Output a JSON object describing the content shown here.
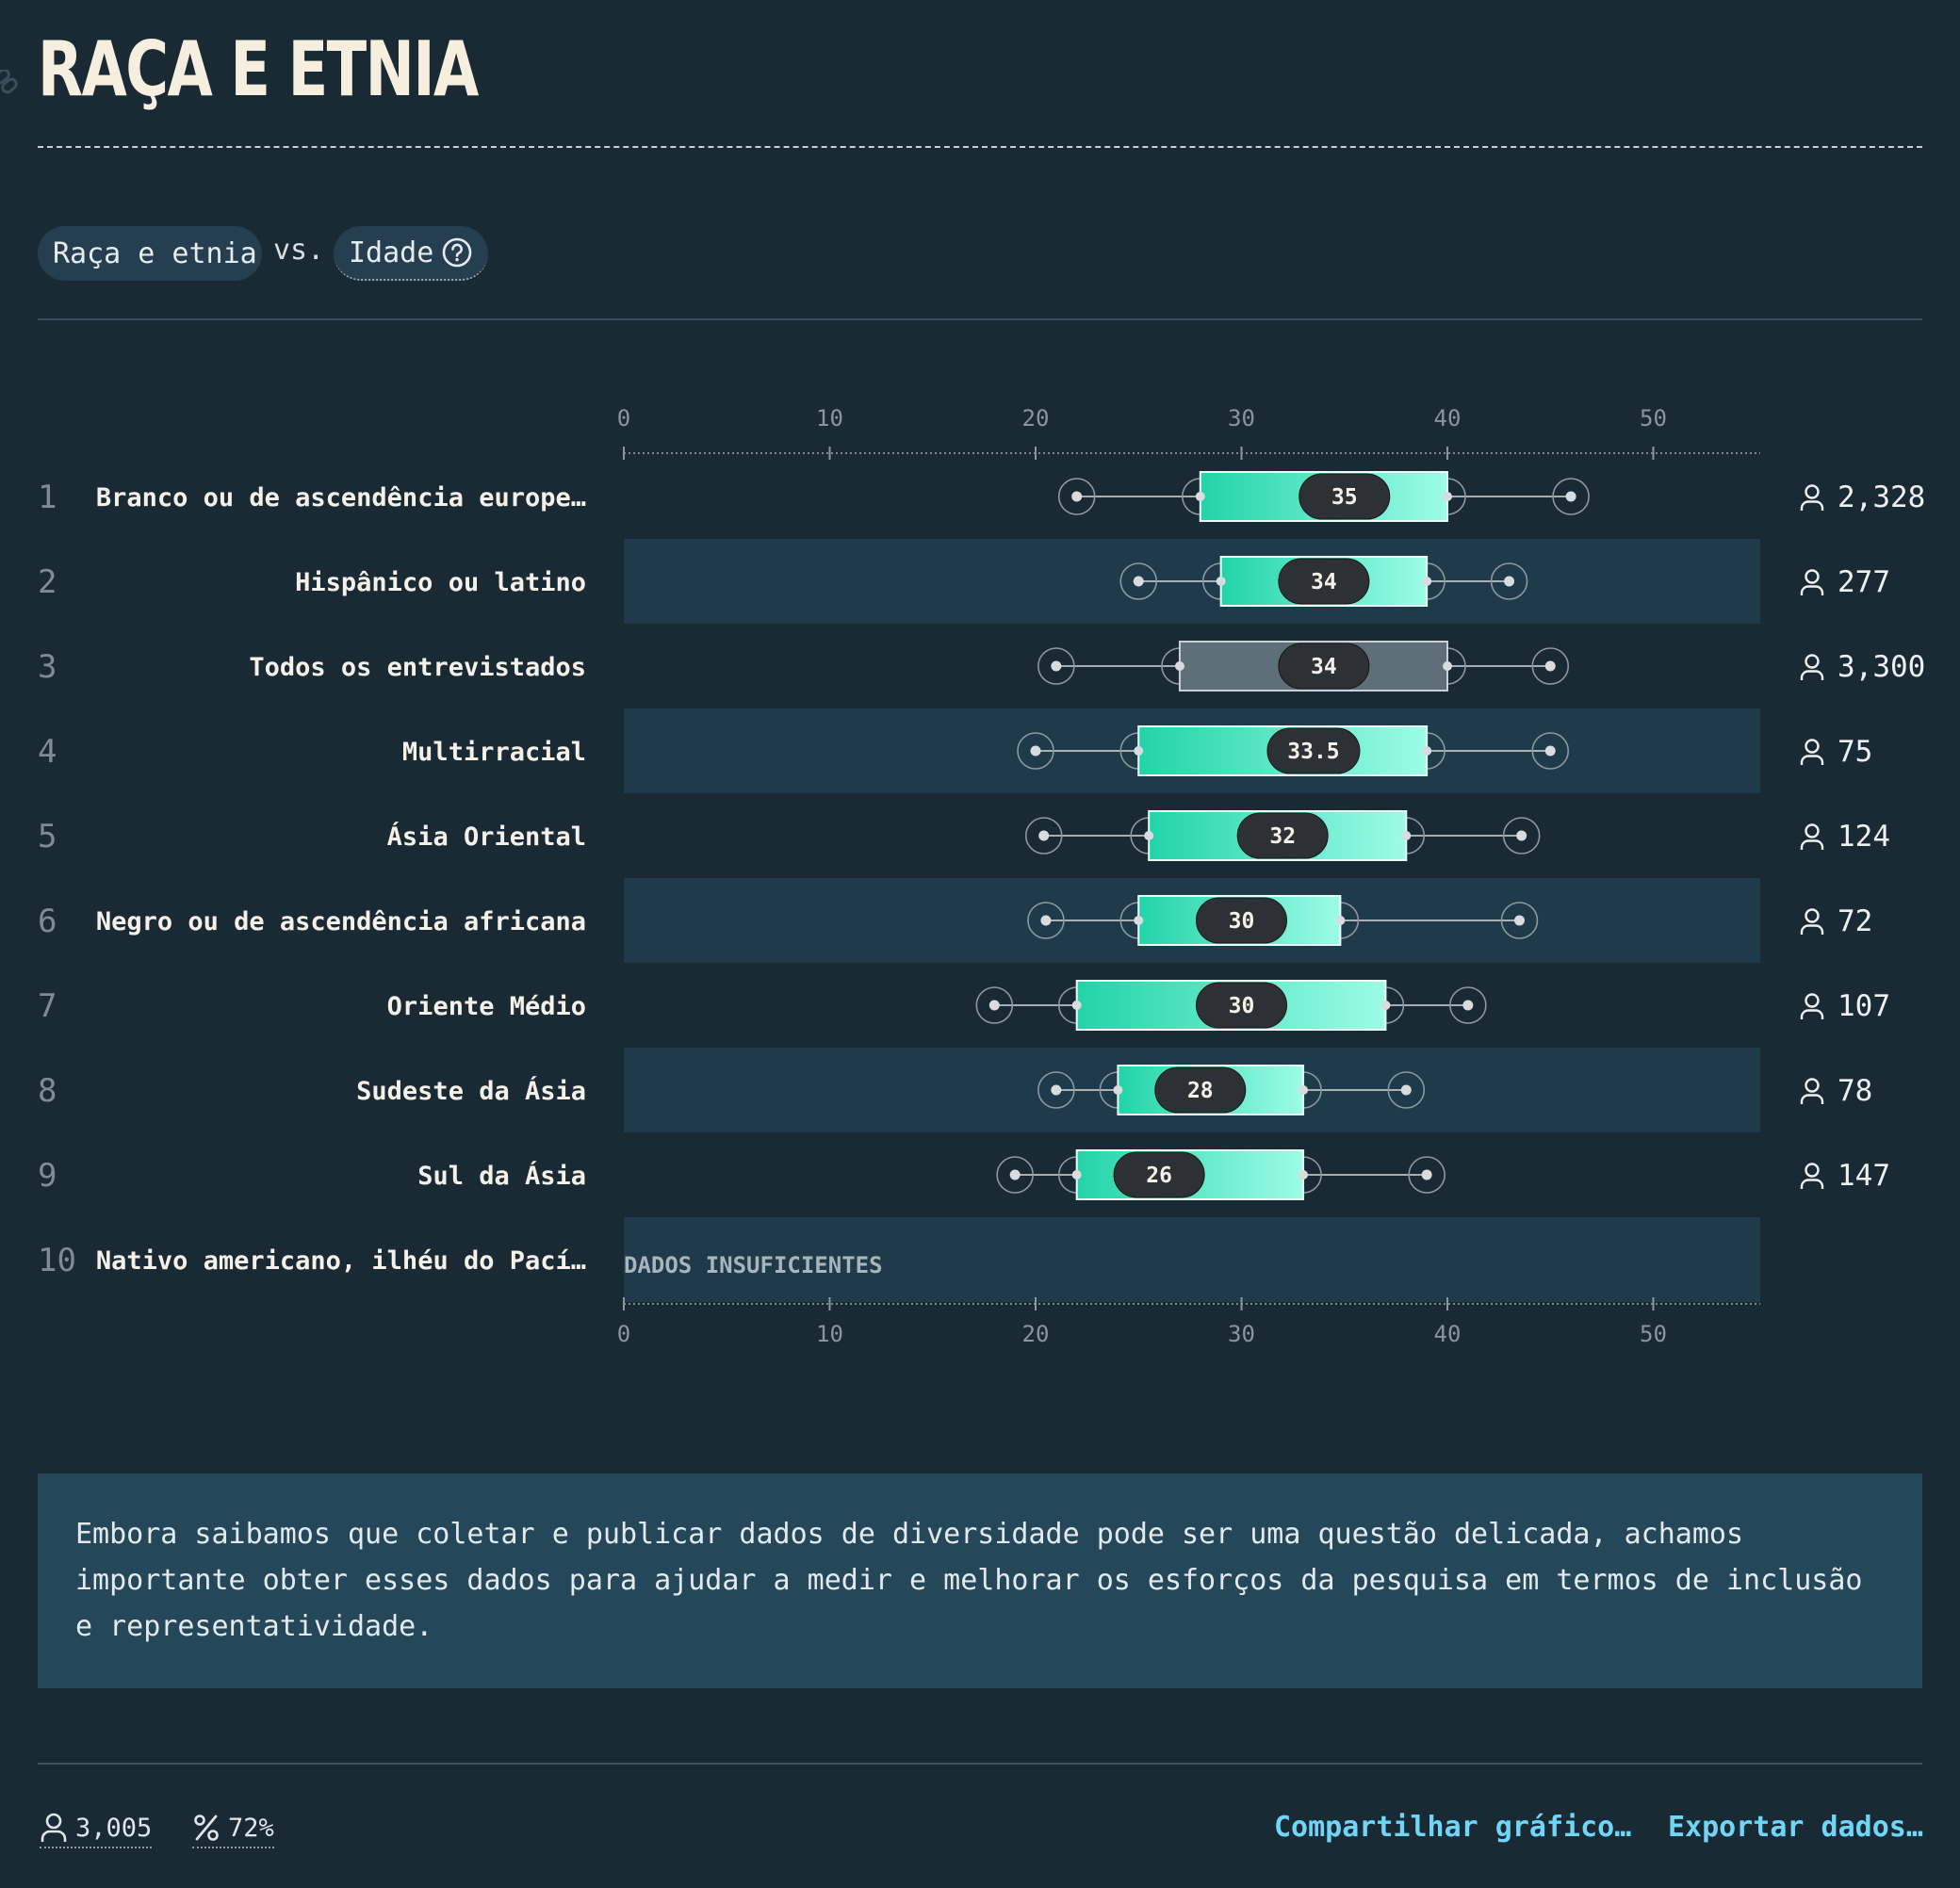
{
  "page": {
    "title": "RAÇA E ETNIA"
  },
  "filters": {
    "group": "Raça e etnia",
    "vs": "vs.",
    "metric": "Idade"
  },
  "chart_data": {
    "type": "boxplot",
    "x_ticks": [
      0,
      10,
      20,
      30,
      40,
      50
    ],
    "xlim": [
      0,
      55
    ],
    "insufficient_label": "DADOS INSUFICIENTES",
    "rows": [
      {
        "rank": "1",
        "label": "Branco ou de ascendência europe…",
        "min": 22,
        "q1": 28,
        "median": 35,
        "median_label": "35",
        "q3": 40,
        "max": 46,
        "count": "2,328",
        "style": "group"
      },
      {
        "rank": "2",
        "label": "Hispânico ou latino",
        "min": 25,
        "q1": 29,
        "median": 34,
        "median_label": "34",
        "q3": 39,
        "max": 43,
        "count": "277",
        "style": "group"
      },
      {
        "rank": "3",
        "label": "Todos os entrevistados",
        "min": 21,
        "q1": 27,
        "median": 34,
        "median_label": "34",
        "q3": 40,
        "max": 45,
        "count": "3,300",
        "style": "total"
      },
      {
        "rank": "4",
        "label": "Multirracial",
        "min": 20,
        "q1": 25,
        "median": 33.5,
        "median_label": "33.5",
        "q3": 39,
        "max": 45,
        "count": "75",
        "style": "group"
      },
      {
        "rank": "5",
        "label": "Ásia Oriental",
        "min": 20.4,
        "q1": 25.5,
        "median": 32,
        "median_label": "32",
        "q3": 38,
        "max": 43.6,
        "count": "124",
        "style": "group"
      },
      {
        "rank": "6",
        "label": "Negro ou de ascendência africana",
        "min": 20.5,
        "q1": 25,
        "median": 30,
        "median_label": "30",
        "q3": 34.8,
        "max": 43.5,
        "count": "72",
        "style": "group"
      },
      {
        "rank": "7",
        "label": "Oriente Médio",
        "min": 18,
        "q1": 22,
        "median": 30,
        "median_label": "30",
        "q3": 37,
        "max": 41,
        "count": "107",
        "style": "group"
      },
      {
        "rank": "8",
        "label": "Sudeste da Ásia",
        "min": 21,
        "q1": 24,
        "median": 28,
        "median_label": "28",
        "q3": 33,
        "max": 38,
        "count": "78",
        "style": "group"
      },
      {
        "rank": "9",
        "label": "Sul da Ásia",
        "min": 19,
        "q1": 22,
        "median": 26,
        "median_label": "26",
        "q3": 33,
        "max": 39,
        "count": "147",
        "style": "group"
      },
      {
        "rank": "10",
        "label": "Nativo americano, ilhéu do Pací…",
        "insufficient": true,
        "style": "group"
      }
    ]
  },
  "note": {
    "text": "Embora saibamos que coletar e publicar dados de diversidade pode ser uma questão delicada, achamos importante obter esses dados para ajudar a medir e melhorar os esforços da pesquisa em termos de inclusão e representatividade."
  },
  "footer": {
    "respondents": "3,005",
    "percent": "72%",
    "share": "Compartilhar gráfico…",
    "export": "Exportar dados…"
  },
  "colors": {
    "background": "#192a35",
    "band": "#1f3a4a",
    "box_start": "#22d4a8",
    "box_end": "#9dfce6",
    "total_box": "#5f6f78",
    "median_pill": "#2d3034",
    "link": "#6fd6f7"
  },
  "icons": {
    "anchor": "link-icon",
    "help": "question-circle-icon",
    "person": "person-icon",
    "percent": "percent-icon"
  }
}
